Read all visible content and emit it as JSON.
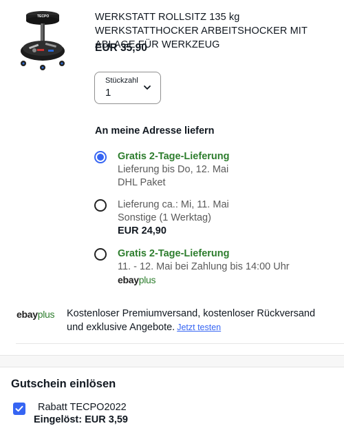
{
  "product": {
    "title": "WERKSTATT ROLLSITZ 135 kg WERKSTATTHOCKER ARBEITSHOCKER MIT ABLAGE FÜR WERKZEUG",
    "price": "EUR 35,90",
    "image_icon": "work-stool-image",
    "image_brand_text": "TECPO"
  },
  "quantity": {
    "label": "Stückzahl",
    "value": "1"
  },
  "delivery": {
    "heading": "An meine Adresse liefern",
    "options": [
      {
        "selected": true,
        "line1": "Gratis 2-Tage-Lieferung",
        "line2": "Lieferung bis Do, 12. Mai",
        "line3": "DHL Paket"
      },
      {
        "selected": false,
        "line1": "Lieferung ca.: Mi, 11. Mai",
        "line2": "Sonstige (1 Werktag)",
        "line3": "EUR 24,90"
      },
      {
        "selected": false,
        "line1": "Gratis 2-Tage-Lieferung",
        "line2": "11. - 12. Mai bei Zahlung bis 14:00 Uhr",
        "logo_ebay": "ebay",
        "logo_plus": "plus"
      }
    ]
  },
  "promo": {
    "logo_ebay": "ebay",
    "logo_plus": "plus",
    "text": "Kostenloser Premiumversand, kostenloser Rückversand und exklusive Angebote.",
    "link": "Jetzt testen"
  },
  "voucher": {
    "heading": "Gutschein einlösen",
    "checked": true,
    "name": "Rabatt TECPO2022",
    "amount": "Eingelöst: EUR 3,59"
  },
  "colors": {
    "accent": "#3665f3",
    "green": "#2d7d2d",
    "text": "#111820",
    "muted": "#5a5a5a"
  }
}
